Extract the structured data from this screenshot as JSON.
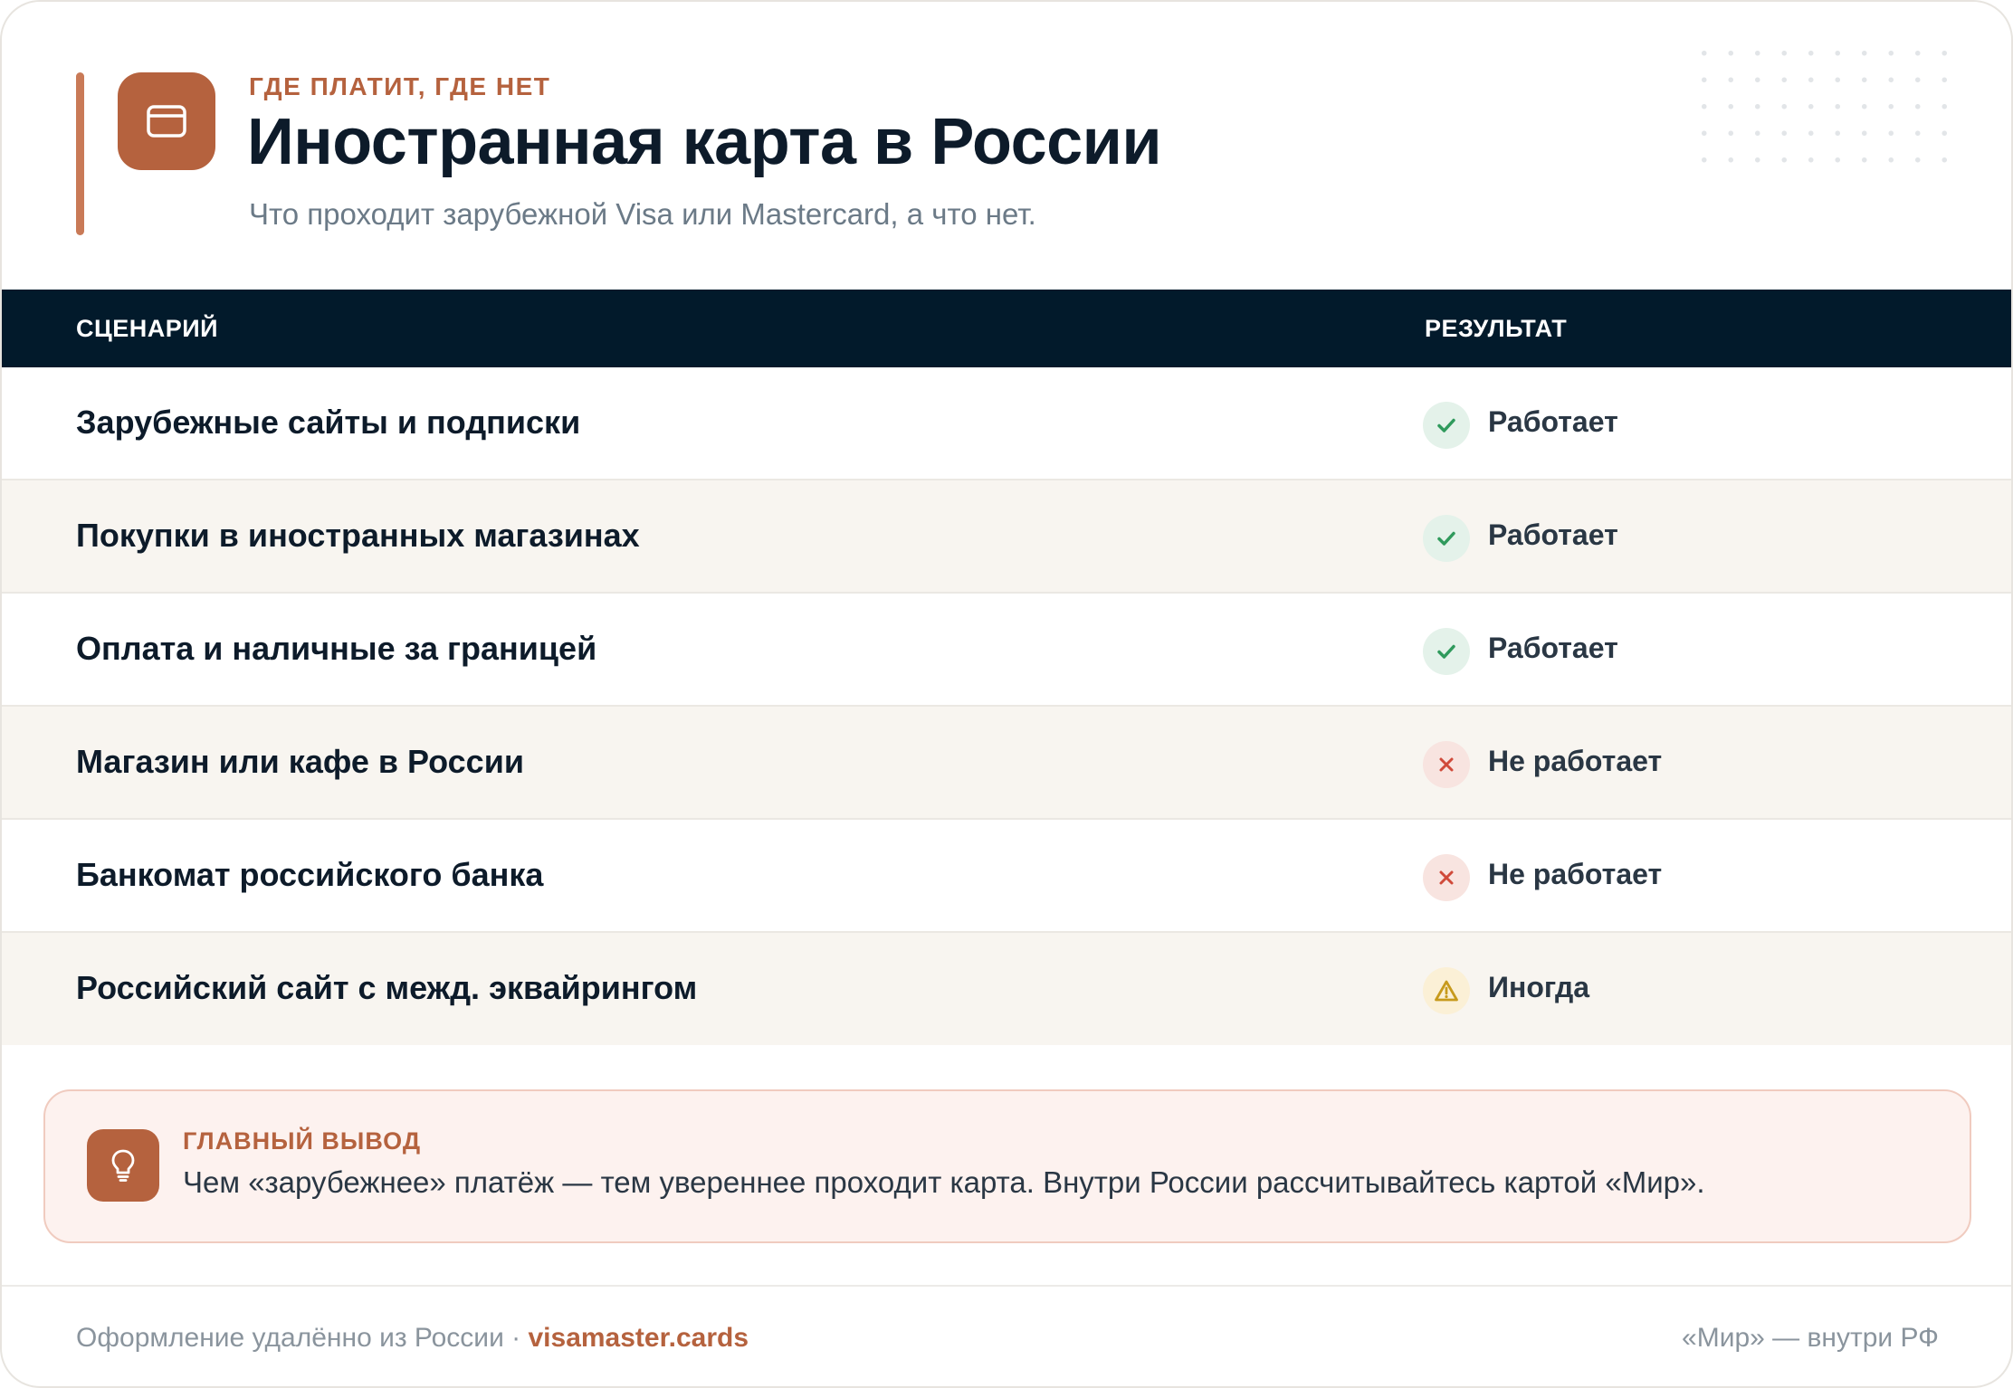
{
  "header": {
    "eyebrow": "ГДЕ ПЛАТИТ, ГДЕ НЕТ",
    "title": "Иностранная карта в России",
    "subtitle": "Что проходит зарубежной Visa или Mastercard, а что нет.",
    "icon": "credit-card-icon"
  },
  "table": {
    "columns": [
      "СЦЕНАРИЙ",
      "РЕЗУЛЬТАТ"
    ],
    "rows": [
      {
        "scenario": "Зарубежные сайты и подписки",
        "status": "Работает",
        "status_icon": "check-icon"
      },
      {
        "scenario": "Покупки в иностранных магазинах",
        "status": "Работает",
        "status_icon": "check-icon"
      },
      {
        "scenario": "Оплата и наличные за границей",
        "status": "Работает",
        "status_icon": "check-icon"
      },
      {
        "scenario": "Магазин или кафе в России",
        "status": "Не работает",
        "status_icon": "cross-icon"
      },
      {
        "scenario": "Банкомат российского банка",
        "status": "Не работает",
        "status_icon": "cross-icon"
      },
      {
        "scenario": "Российский сайт с межд. эквайрингом",
        "status": "Иногда",
        "status_icon": "warning-icon"
      }
    ]
  },
  "conclusion": {
    "title": "ГЛАВНЫЙ ВЫВОД",
    "text": "Чем «зарубежнее» платёж — тем увереннее проходит карта. Внутри России рассчитывайтесь картой «Мир».",
    "icon": "lightbulb-icon"
  },
  "footer": {
    "left_text": "Оформление удалённо из России · ",
    "link": "visamaster.cards",
    "right_text": "«Мир» — внутри РФ"
  },
  "colors": {
    "accent": "#b5623e",
    "header_bg": "#021a2b",
    "ok": "#2f9a5c",
    "no": "#d04a3a",
    "warn": "#c79a1c"
  }
}
